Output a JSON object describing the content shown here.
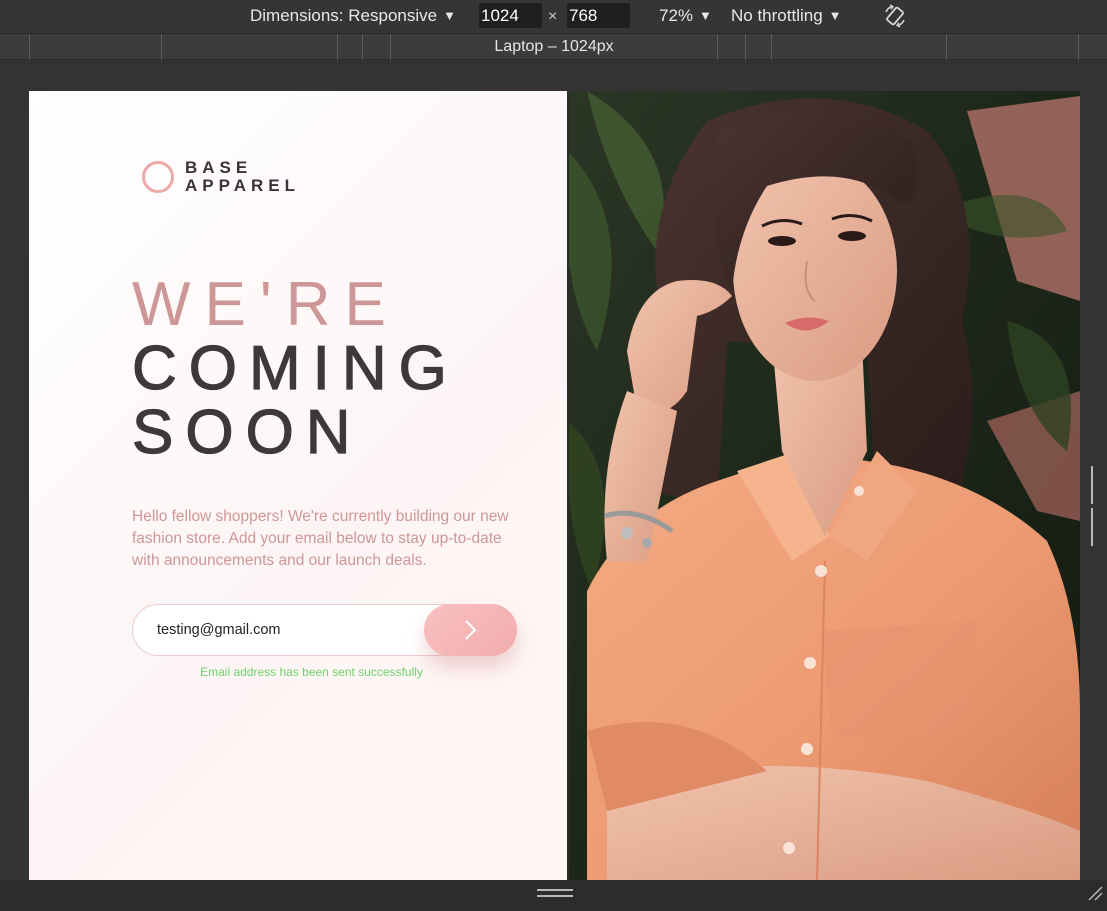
{
  "devtools": {
    "dimensions_label": "Dimensions: Responsive",
    "width": "1024",
    "times": "×",
    "height": "768",
    "zoom": "72%",
    "throttling": "No throttling",
    "media_query_label": "Laptop – 1024px",
    "icons": {
      "dropdown": "caret-down-icon",
      "rotate": "rotate-icon",
      "drag": "drag-handle-icon",
      "resize": "resize-grip-icon"
    }
  },
  "page": {
    "logo": {
      "line1": "BASE",
      "line2": "APPAREL"
    },
    "headline": {
      "line1": "WE'RE",
      "line2": "COMING",
      "line3": "SOON"
    },
    "description": "Hello fellow shoppers! We're currently building our new fashion store. Add your email below to stay up-to-date with announcements and our launch deals.",
    "email_value": "testing@gmail.com",
    "status_message": "Email address has been sent successfully",
    "colors": {
      "accent_pink": "#CE9797",
      "dark_text": "#3E3838",
      "button_pink": "#F2ADAD",
      "success_green": "#6ED46A",
      "shirt_orange": "#F0A07A"
    }
  }
}
